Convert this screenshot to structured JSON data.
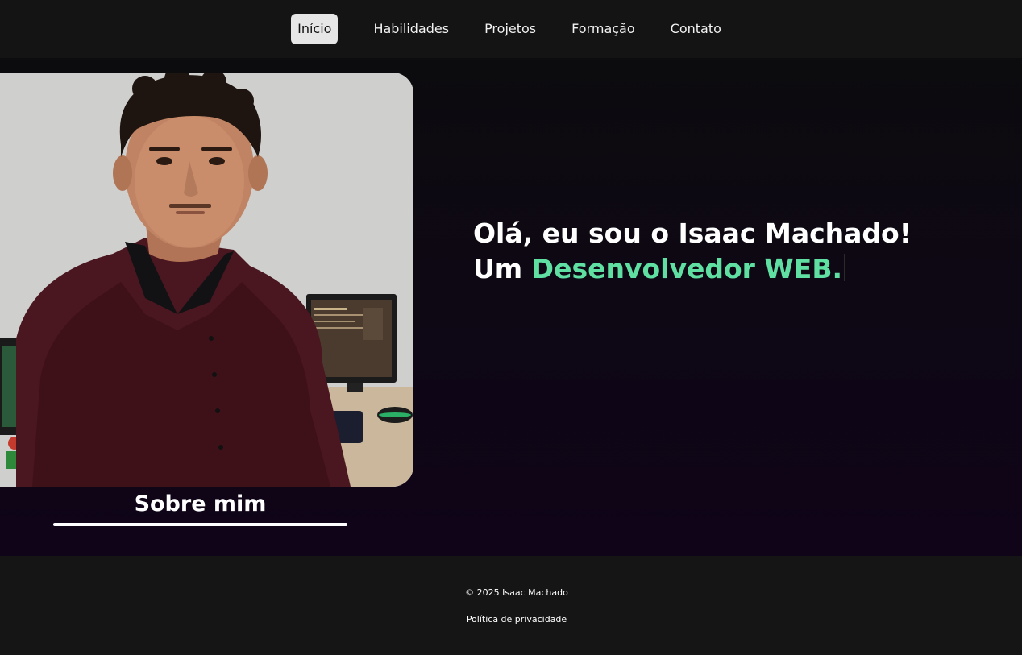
{
  "nav": {
    "items": [
      {
        "label": "Início",
        "active": true
      },
      {
        "label": "Habilidades",
        "active": false
      },
      {
        "label": "Projetos",
        "active": false
      },
      {
        "label": "Formação",
        "active": false
      },
      {
        "label": "Contato",
        "active": false
      }
    ]
  },
  "hero": {
    "greeting": "Olá, eu sou o Isaac Machado!",
    "role_prefix": "Um ",
    "role_highlight": "Desenvolvedor WEB.",
    "about_title": "Sobre mim"
  },
  "footer": {
    "copyright": "© 2025 Isaac Machado",
    "privacy": "Política de privacidade"
  },
  "colors": {
    "accent": "#5fe0a2",
    "background": "#0e0814",
    "nav_active_bg": "#e6e6e6"
  }
}
